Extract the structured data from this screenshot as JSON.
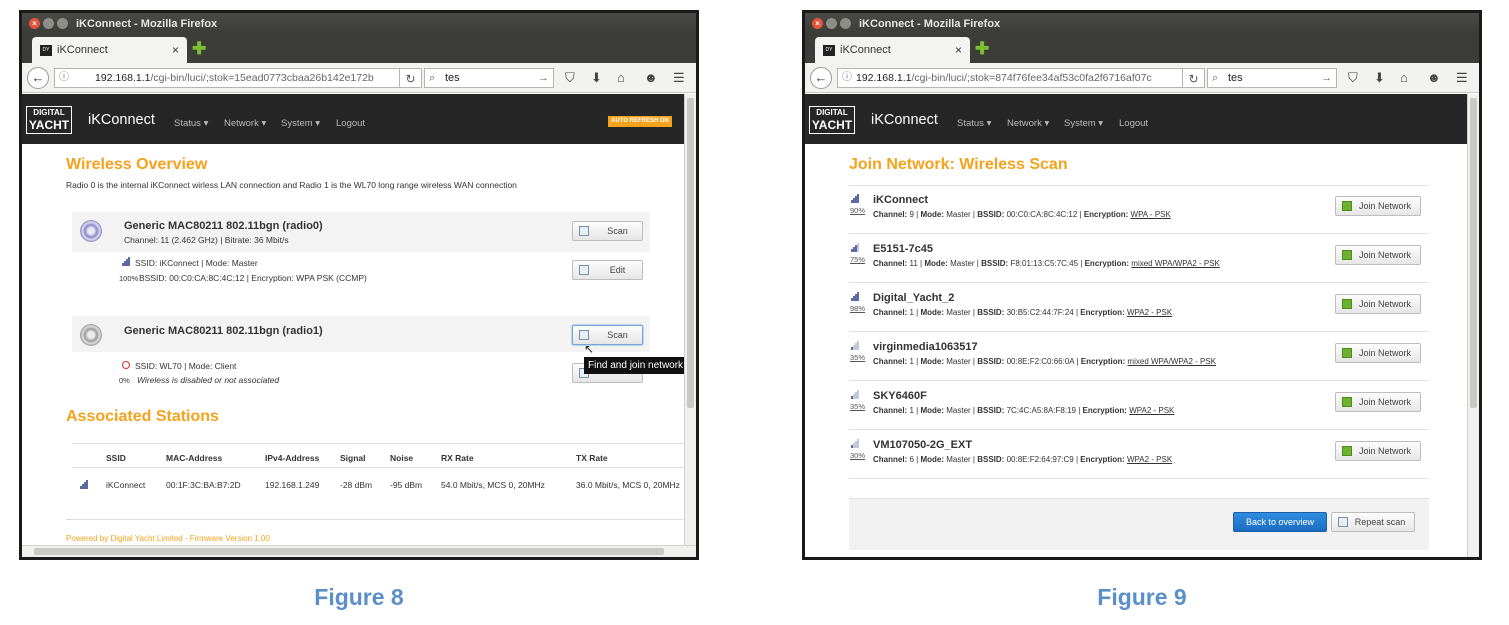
{
  "fig8": {
    "caption": "Figure 8",
    "window_title": "iKConnect - Mozilla Firefox",
    "tab_title": "iKConnect",
    "url_host": "192.168.1.1",
    "url_path": "/cgi-bin/luci/;stok=15ead0773cbaa26b142e172b",
    "search_value": "tes",
    "brand": "iKConnect",
    "logo_top": "DIGITAL",
    "logo_bottom": "YACHT",
    "menu": [
      "Status ▾",
      "Network ▾",
      "System ▾",
      "Logout"
    ],
    "auto_refresh": "AUTO REFRESH ON",
    "overview_title": "Wireless Overview",
    "overview_desc": "Radio 0 is the internal iKConnect wirless LAN connection and Radio 1 is the WL70 long range wireless WAN connection",
    "radio0": {
      "title": "Generic MAC80211 802.11bgn (radio0)",
      "info": "Channel: 11 (2.462 GHz) | Bitrate: 36 Mbit/s",
      "ssid_line": "SSID: iKConnect | Mode: Master",
      "pct": "100%",
      "bssid_line": "BSSID: 00:C0:CA:8C:4C:12 | Encryption: WPA PSK (CCMP)",
      "scan_label": "Scan",
      "edit_label": "Edit"
    },
    "radio1": {
      "title": "Generic MAC80211 802.11bgn (radio1)",
      "scan_label": "Scan",
      "ssid_line": "SSID: WL70 | Mode: Client",
      "pct": "0%",
      "status": "Wireless is disabled or not associated"
    },
    "tooltip": "Find and join network",
    "stations_title": "Associated Stations",
    "stations_headers": [
      "SSID",
      "MAC-Address",
      "IPv4-Address",
      "Signal",
      "Noise",
      "RX Rate",
      "TX Rate"
    ],
    "station": [
      "iKConnect",
      "00:1F:3C:BA:B7:2D",
      "192.168.1.249",
      "-28 dBm",
      "-95 dBm",
      "54.0 Mbit/s, MCS 0, 20MHz",
      "36.0 Mbit/s, MCS 0, 20MHz"
    ],
    "footer": "Powered by Digital Yacht Limited - Firmware Version 1.00"
  },
  "fig9": {
    "caption": "Figure 9",
    "window_title": "iKConnect - Mozilla Firefox",
    "tab_title": "iKConnect",
    "url_host": "192.168.1.1",
    "url_path": "/cgi-bin/luci/;stok=874f76fee34af53c0fa2f6716af07c",
    "search_value": "tes",
    "brand": "iKConnect",
    "logo_top": "DIGITAL",
    "logo_bottom": "YACHT",
    "menu": [
      "Status ▾",
      "Network ▾",
      "System ▾",
      "Logout"
    ],
    "title": "Join Network: Wireless Scan",
    "join_label": "Join Network",
    "networks": [
      {
        "name": "iKConnect",
        "pct": "90%",
        "channel": "9",
        "mode": "Master",
        "bssid": "00:C0:CA:8C:4C:12",
        "enc": "WPA - PSK"
      },
      {
        "name": "E5151-7c45",
        "pct": "75%",
        "channel": "11",
        "mode": "Master",
        "bssid": "F8:01:13:C5:7C:45",
        "enc": "mixed WPA/WPA2 - PSK"
      },
      {
        "name": "Digital_Yacht_2",
        "pct": "98%",
        "channel": "1",
        "mode": "Master",
        "bssid": "30:B5:C2:44:7F:24",
        "enc": "WPA2 - PSK"
      },
      {
        "name": "virginmedia1063517",
        "pct": "35%",
        "channel": "1",
        "mode": "Master",
        "bssid": "00:8E:F2:C0:66:0A",
        "enc": "mixed WPA/WPA2 - PSK"
      },
      {
        "name": "SKY6460F",
        "pct": "35%",
        "channel": "1",
        "mode": "Master",
        "bssid": "7C:4C:A5:8A:F8:19",
        "enc": "WPA2 - PSK"
      },
      {
        "name": "VM107050-2G_EXT",
        "pct": "30%",
        "channel": "6",
        "mode": "Master",
        "bssid": "00:8E:F2:64:97:C9",
        "enc": "WPA2 - PSK"
      }
    ],
    "labels": {
      "channel": "Channel:",
      "mode": "Mode:",
      "bssid": "BSSID:",
      "enc": "Encryption:"
    },
    "back_label": "Back to overview",
    "repeat_label": "Repeat scan"
  },
  "colors": {
    "accent": "#f5a21c",
    "caption": "#5b8fc8",
    "header": "#262626",
    "primary": "#1b6cc1"
  }
}
